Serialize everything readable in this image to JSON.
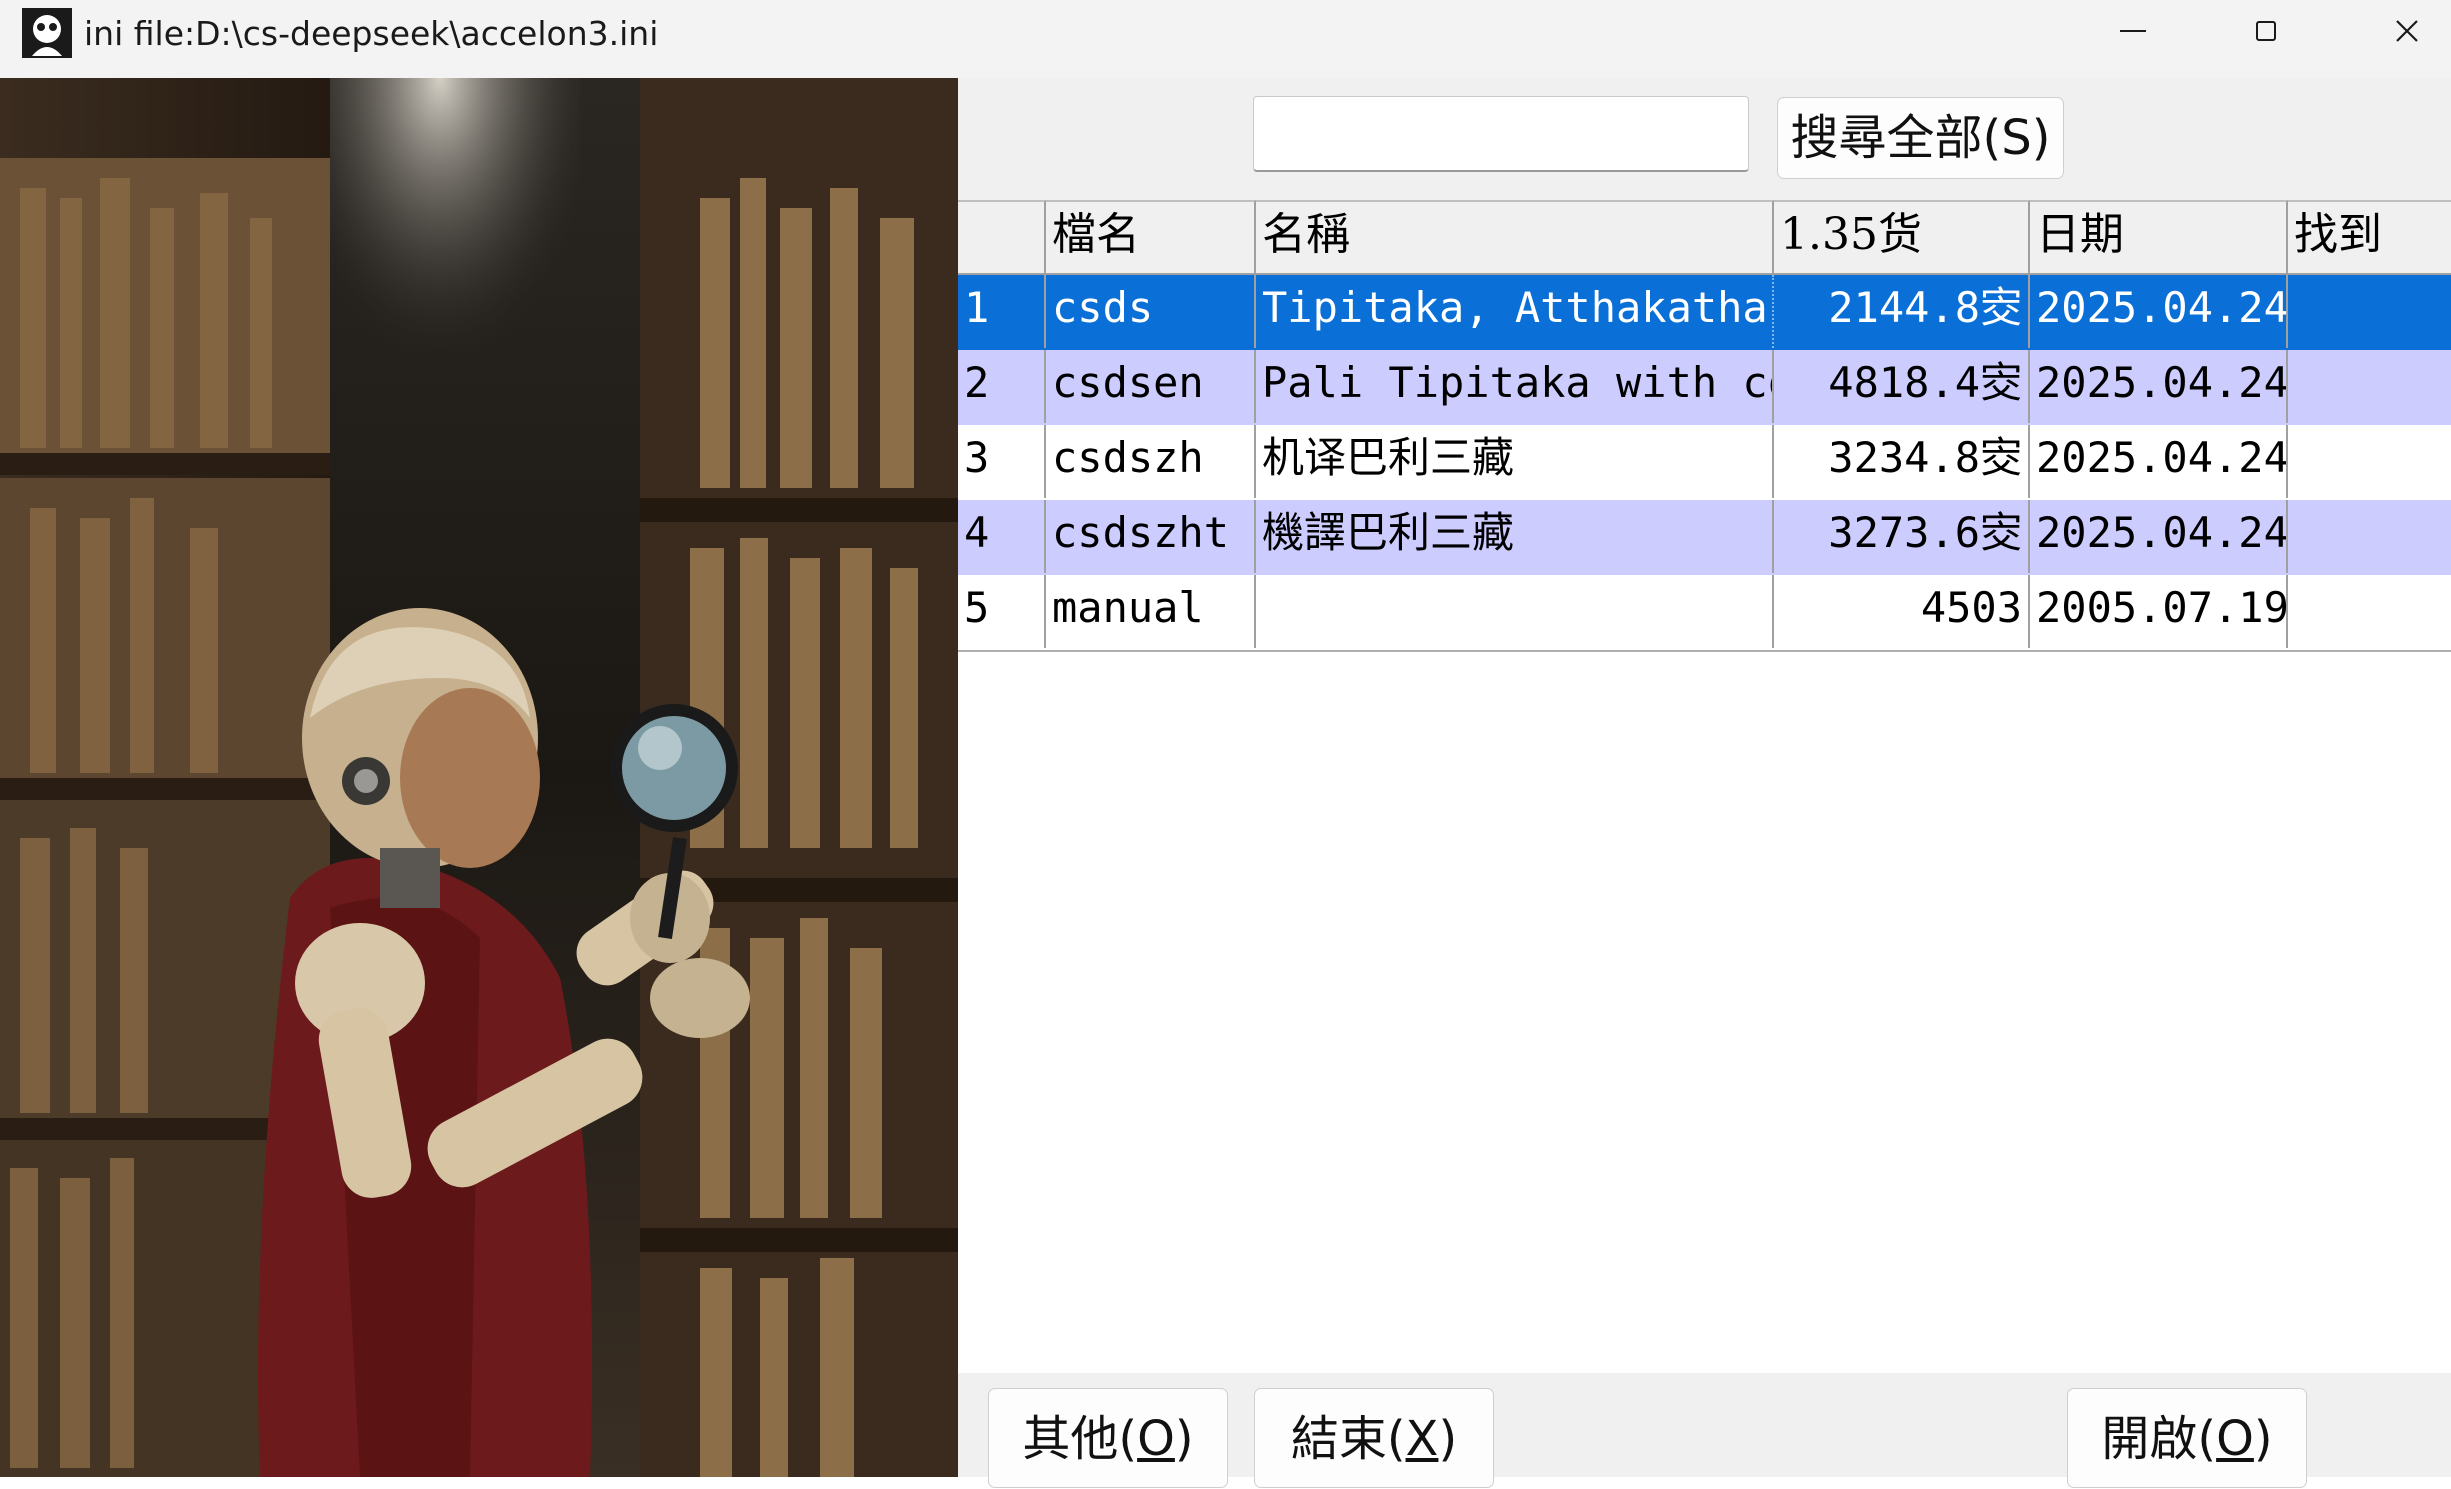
{
  "window": {
    "title": "ini file:D:\\cs-deepseek\\accelon3.ini",
    "minimize_icon": "minimize-icon",
    "maximize_icon": "maximize-icon",
    "close_icon": "close-icon"
  },
  "search": {
    "value": "",
    "button_label": "搜尋全部(S)"
  },
  "table": {
    "columns": [
      "",
      "檔名",
      "名稱",
      "1.35货",
      "日期",
      "找到"
    ],
    "rows": [
      {
        "no": "1",
        "file": "csds",
        "name": "Tipitaka, Atthakatha,",
        "size": "2144.8㝔",
        "date": "2025.04.24",
        "found": "",
        "state": "selected"
      },
      {
        "no": "2",
        "file": "csdsen",
        "name": "Pali Tipitaka with co:",
        "size": "4818.4㝔",
        "date": "2025.04.24",
        "found": "",
        "state": "alt"
      },
      {
        "no": "3",
        "file": "csdszh",
        "name": "机译巴利三藏",
        "size": "3234.8㝔",
        "date": "2025.04.24",
        "found": "",
        "state": "plain"
      },
      {
        "no": "4",
        "file": "csdszht",
        "name": "機譯巴利三藏",
        "size": "3273.6㝔",
        "date": "2025.04.24",
        "found": "",
        "state": "alt"
      },
      {
        "no": "5",
        "file": "manual",
        "name": "",
        "size": "4503",
        "date": "2005.07.19",
        "found": "",
        "state": "plain"
      }
    ]
  },
  "buttons": {
    "other": {
      "text": "其他(",
      "key": "O",
      "end": ")"
    },
    "exit": {
      "text": "結束(",
      "key": "X",
      "end": ")"
    },
    "open": {
      "text": "開啟(",
      "key": "O",
      "end": ")"
    }
  },
  "image": {
    "description_icon": "robot-monk-library-photo"
  }
}
